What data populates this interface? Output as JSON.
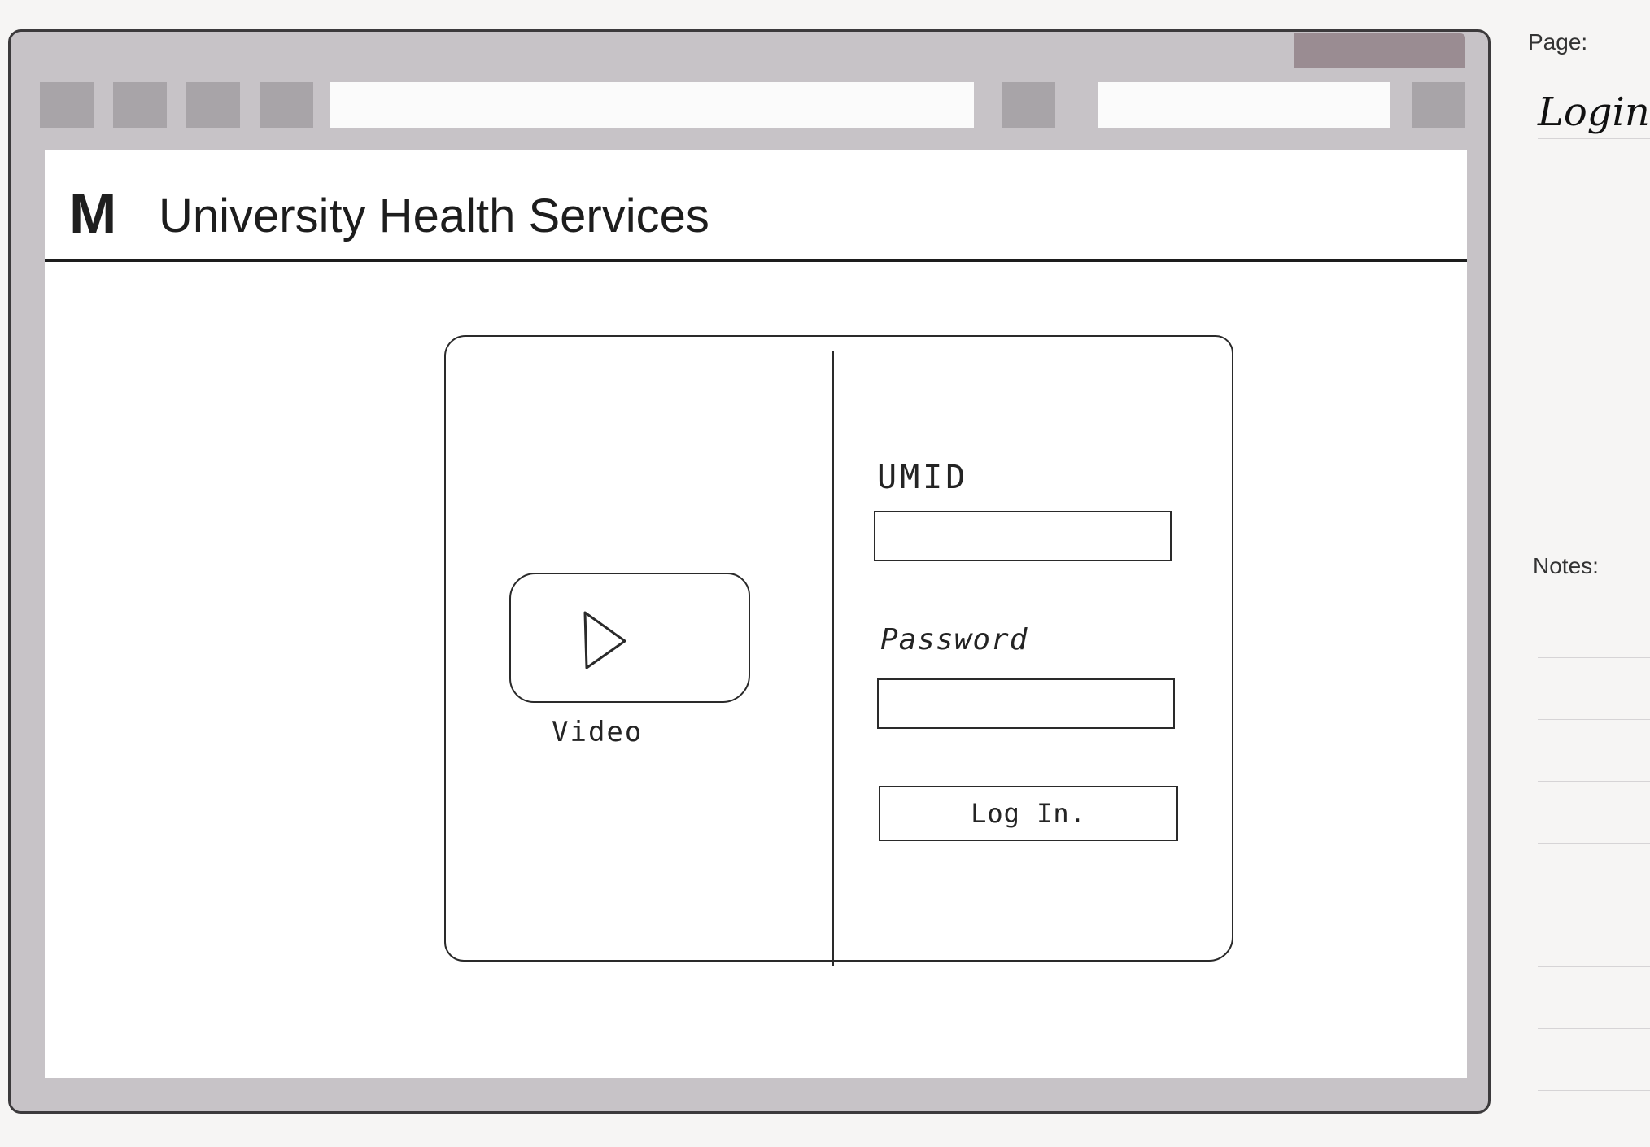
{
  "header": {
    "logo_letter": "M",
    "site_title": "University Health Services"
  },
  "login_panel": {
    "video_label": "Video",
    "umid_label": "UMID",
    "umid_value": "",
    "password_label": "Password",
    "password_value": "",
    "login_button": "Log In."
  },
  "sidebar": {
    "page_label": "Page:",
    "page_value": "Login.",
    "notes_label": "Notes:"
  },
  "colors": {
    "browser_frame": "#c7c3c7",
    "toolbar_accent": "#9a8c92",
    "ink": "#2a2a2a"
  }
}
